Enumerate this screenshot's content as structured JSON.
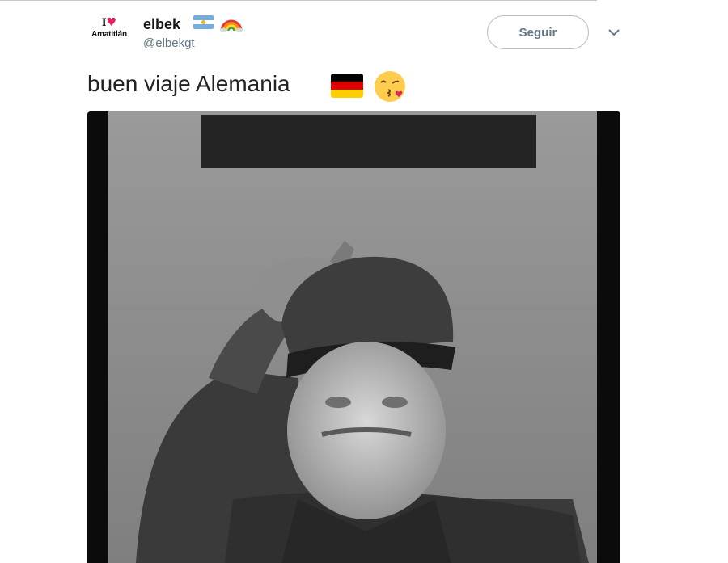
{
  "tweet": {
    "avatar": {
      "line1": "I",
      "heart": "♥",
      "line2": "Amatitlán"
    },
    "display_name": "elbek",
    "username": "@elbekgt",
    "follow_label": "Seguir",
    "text": "buen viaje Alemania",
    "emoji": [
      "flag-argentina-icon",
      "rainbow-icon",
      "flag-germany-icon",
      "face-blowing-kiss-icon"
    ],
    "colors": {
      "argentina_blue": "#74acdf",
      "germany": [
        "#000000",
        "#dd0000",
        "#ffce00"
      ],
      "secondary_text": "#657786"
    }
  }
}
